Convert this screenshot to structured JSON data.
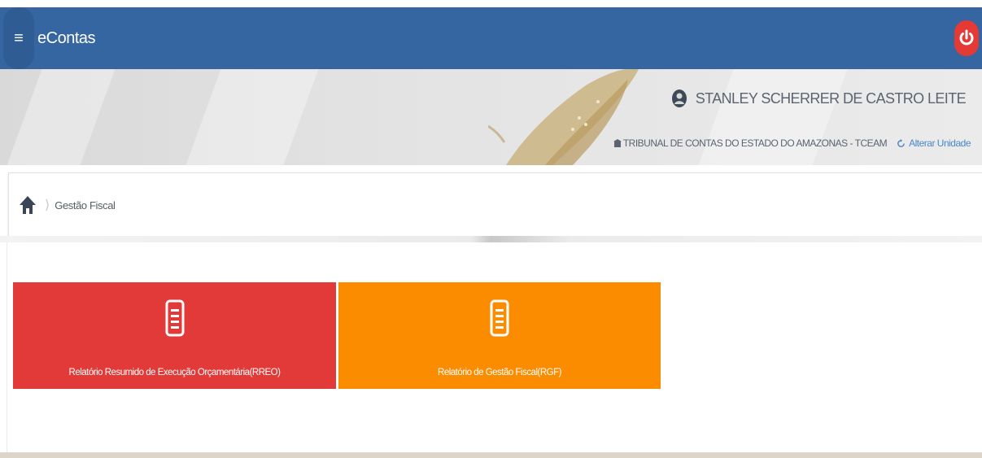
{
  "navbar": {
    "brand": "eContas",
    "menu_icon": "hamburger-icon",
    "power_icon": "power-icon"
  },
  "header": {
    "user_name": "STANLEY SCHERRER DE CASTRO LEITE",
    "unit_name": "TRIBUNAL DE CONTAS DO ESTADO DO AMAZONAS - TCEAM",
    "alter_unit_label": "Alterar Unidade"
  },
  "breadcrumb": {
    "home_icon": "home-icon",
    "current": "Gestão Fiscal"
  },
  "tiles": [
    {
      "label": "Relatório Resumido de Execução Orçamentária(RREO)",
      "color": "#e23a38",
      "icon": "document-icon"
    },
    {
      "label": "Relatório de Gestão Fiscal(RGF)",
      "color": "#fb8c00",
      "icon": "document-icon"
    }
  ],
  "colors": {
    "navbar": "#3566a1",
    "link": "#4a89c8",
    "power": "#e53935"
  }
}
